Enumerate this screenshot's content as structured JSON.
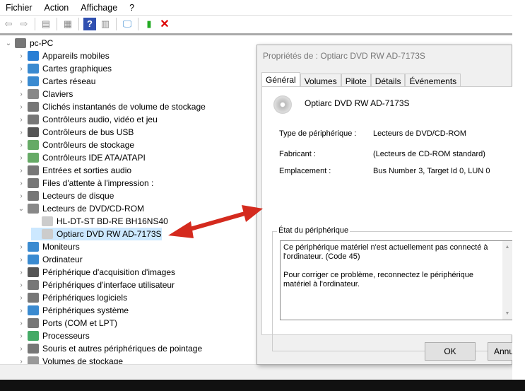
{
  "menu": [
    "Fichier",
    "Action",
    "Affichage",
    "?"
  ],
  "tree": {
    "root": "pc-PC",
    "items": [
      "Appareils mobiles",
      "Cartes graphiques",
      "Cartes réseau",
      "Claviers",
      "Clichés instantanés de volume de stockage",
      "Contrôleurs audio, vidéo et jeu",
      "Contrôleurs de bus USB",
      "Contrôleurs de stockage",
      "Contrôleurs IDE ATA/ATAPI",
      "Entrées et sorties audio",
      "Files d'attente à l'impression :",
      "Lecteurs de disque",
      "Lecteurs de DVD/CD-ROM"
    ],
    "children": [
      "HL-DT-ST BD-RE  BH16NS40",
      "Optiarc DVD RW AD-7173S"
    ],
    "items2": [
      "Moniteurs",
      "Ordinateur",
      "Périphérique d'acquisition d'images",
      "Périphériques d'interface utilisateur",
      "Périphériques logiciels",
      "Périphériques système",
      "Ports (COM et LPT)",
      "Processeurs",
      "Souris et autres périphériques de pointage",
      "Volumes de stockage"
    ]
  },
  "dialog": {
    "title": "Propriétés de : Optiarc DVD RW AD-7173S",
    "tabs": [
      "Général",
      "Volumes",
      "Pilote",
      "Détails",
      "Événements"
    ],
    "device_name": "Optiarc DVD RW AD-7173S",
    "type_label": "Type de périphérique :",
    "type_value": "Lecteurs de DVD/CD-ROM",
    "maker_label": "Fabricant :",
    "maker_value": "(Lecteurs de CD-ROM standard)",
    "location_label": "Emplacement :",
    "location_value": "Bus Number 3, Target Id 0, LUN 0",
    "status_group": "État du périphérique",
    "status_text1": "Ce périphérique matériel n'est actuellement pas connecté à l'ordinateur.  (Code 45)",
    "status_text2": "Pour corriger ce problème, reconnectez le périphérique matériel à l'ordinateur.",
    "ok": "OK",
    "cancel": "Annu"
  },
  "colors": {
    "arrow": "#d42a1e",
    "selection": "#cce8ff"
  }
}
